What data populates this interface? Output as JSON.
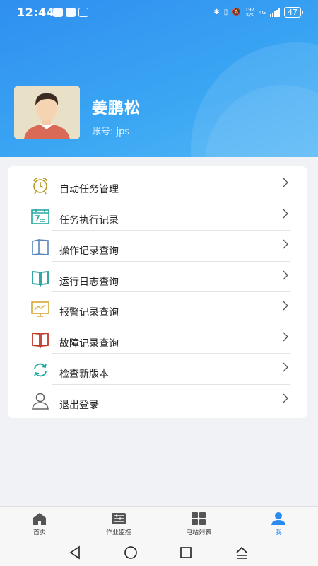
{
  "status_bar": {
    "time": "12:44",
    "battery": "47",
    "net_speed": "197\nK/s",
    "network": "4G"
  },
  "profile": {
    "name": "姜鹏松",
    "account": "账号: jps"
  },
  "menu": [
    {
      "label": "自动任务管理",
      "icon": "alarm-clock-icon"
    },
    {
      "label": "任务执行记录",
      "icon": "calendar-record-icon"
    },
    {
      "label": "操作记录查询",
      "icon": "open-book-icon"
    },
    {
      "label": "运行日志查询",
      "icon": "log-book-icon"
    },
    {
      "label": "报警记录查询",
      "icon": "monitor-chart-icon"
    },
    {
      "label": "故障记录查询",
      "icon": "red-book-icon"
    },
    {
      "label": "检查新版本",
      "icon": "refresh-icon"
    },
    {
      "label": "退出登录",
      "icon": "user-outline-icon"
    }
  ],
  "tabs": [
    {
      "label": "首页",
      "icon": "home-icon"
    },
    {
      "label": "作业监控",
      "icon": "monitor-list-icon"
    },
    {
      "label": "电站列表",
      "icon": "grid-icon"
    },
    {
      "label": "我",
      "icon": "user-icon"
    }
  ],
  "colors": {
    "accent": "#2a8cf0",
    "header": "#3aa6f3"
  }
}
